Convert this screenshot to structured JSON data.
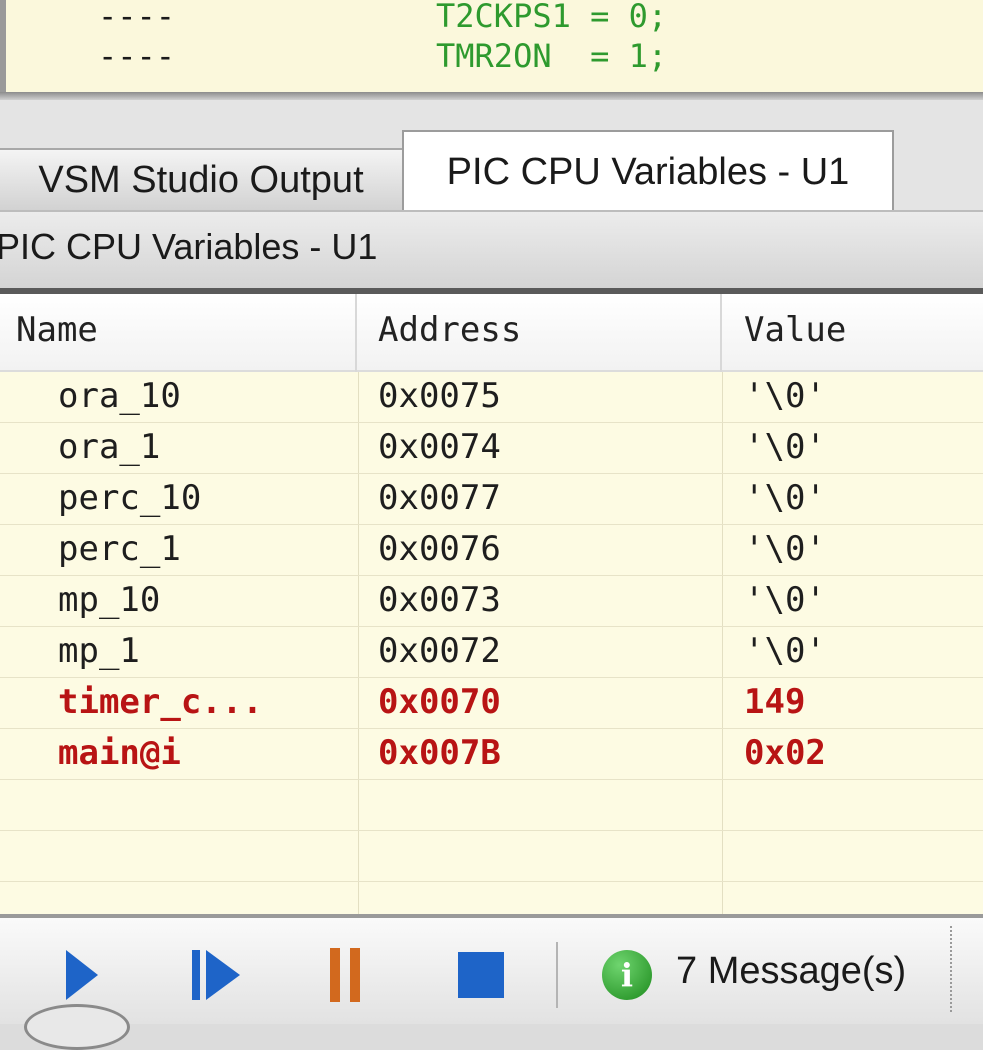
{
  "code": {
    "lines": [
      {
        "marker": "----",
        "text": "T2CKPS1 = 0;"
      },
      {
        "marker": "----",
        "text": "TMR2ON  = 1;"
      }
    ]
  },
  "tabs": [
    {
      "label": "VSM Studio Output",
      "active": false
    },
    {
      "label": "PIC CPU Variables - U1",
      "active": true
    }
  ],
  "panel": {
    "title": "PIC CPU Variables - U1"
  },
  "table": {
    "columns": [
      "Name",
      "Address",
      "Value"
    ],
    "rows": [
      {
        "name": "ora_10",
        "address": "0x0075",
        "value": "'\\0'",
        "changed": false
      },
      {
        "name": "ora_1",
        "address": "0x0074",
        "value": "'\\0'",
        "changed": false
      },
      {
        "name": "perc_10",
        "address": "0x0077",
        "value": "'\\0'",
        "changed": false
      },
      {
        "name": "perc_1",
        "address": "0x0076",
        "value": "'\\0'",
        "changed": false
      },
      {
        "name": "mp_10",
        "address": "0x0073",
        "value": "'\\0'",
        "changed": false
      },
      {
        "name": "mp_1",
        "address": "0x0072",
        "value": "'\\0'",
        "changed": false
      },
      {
        "name": "timer_c...",
        "address": "0x0070",
        "value": "149",
        "changed": true
      },
      {
        "name": "main@i",
        "address": "0x007B",
        "value": "0x02",
        "changed": true
      }
    ]
  },
  "toolbar": {
    "buttons": [
      {
        "name": "play-button",
        "icon": "play-icon"
      },
      {
        "name": "step-button",
        "icon": "step-icon"
      },
      {
        "name": "pause-button",
        "icon": "pause-icon"
      },
      {
        "name": "stop-button",
        "icon": "stop-icon"
      }
    ],
    "message_icon": "info-icon",
    "message_icon_glyph": "i",
    "messages": "7 Message(s)"
  },
  "colors": {
    "changed_value": "#b81414",
    "code_text": "#2e9a2e",
    "grid_background": "#fdfbe3",
    "play_blue": "#1e64c8",
    "pause_orange": "#d2691e"
  }
}
